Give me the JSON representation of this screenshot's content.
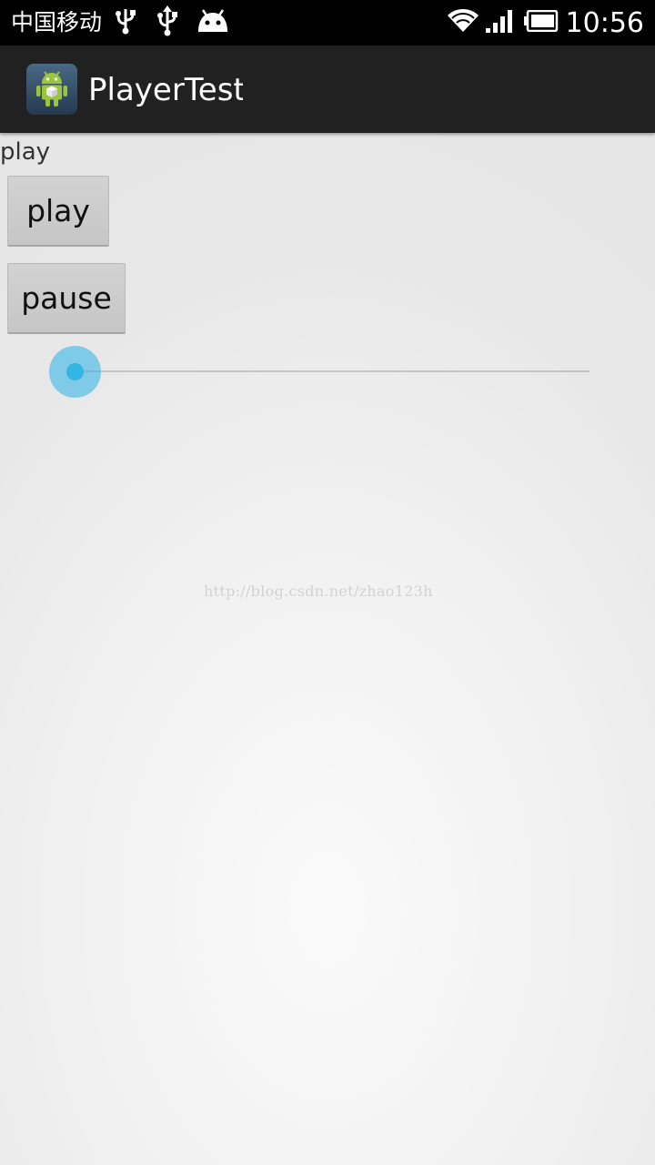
{
  "status_bar": {
    "carrier": "中国移动",
    "time": "10:56",
    "icons": [
      "usb-icon",
      "usb-icon",
      "android-icon",
      "wifi-icon",
      "signal-icon",
      "battery-icon"
    ]
  },
  "action_bar": {
    "title": "PlayerTest",
    "icon": "android-app-icon"
  },
  "content": {
    "status_text": "play",
    "play_button": "play",
    "pause_button": "pause",
    "seekbar_progress": 0
  },
  "watermark": "http://blog.csdn.net/zhao123h",
  "colors": {
    "accent": "#33b5e5",
    "action_bar": "#212121",
    "status_bar": "#000000",
    "button": "#cccccc"
  }
}
